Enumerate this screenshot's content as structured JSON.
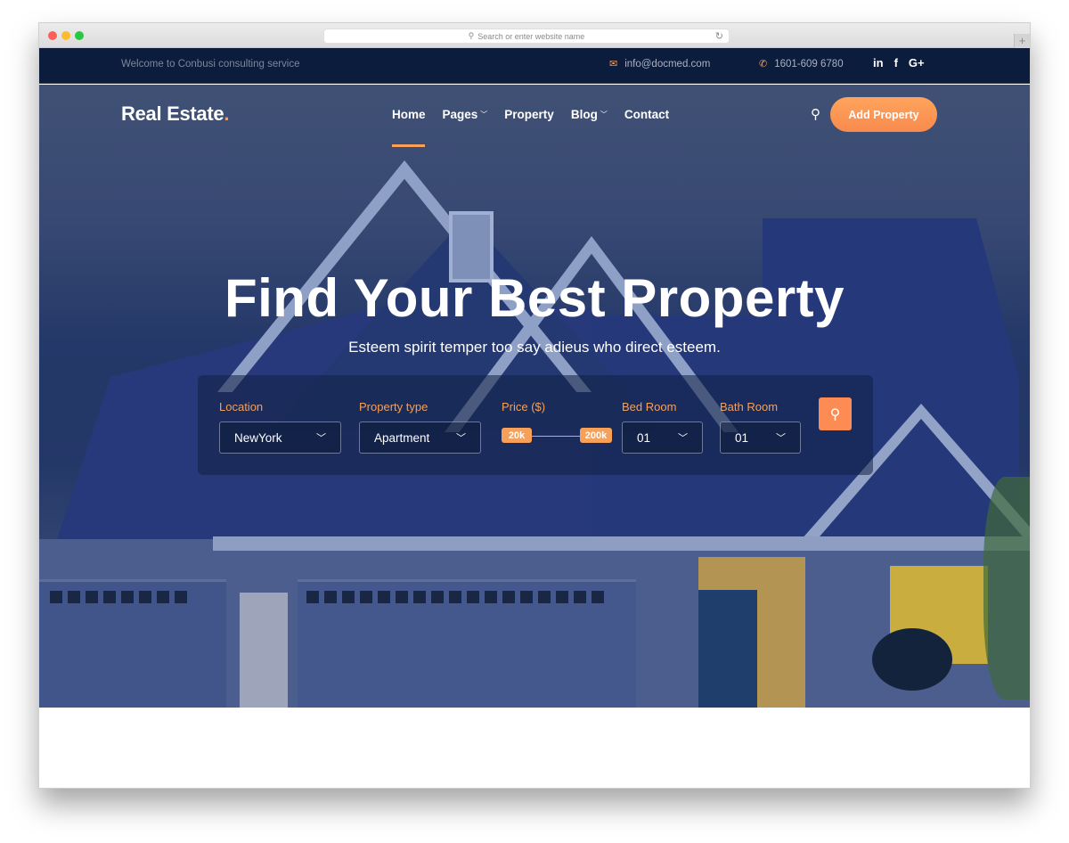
{
  "browser": {
    "url_placeholder": "Search or enter website name",
    "search_icon": "magnifier-icon",
    "reload_icon": "reload-icon",
    "new_tab": "+"
  },
  "topbar": {
    "welcome": "Welcome to Conbusi consulting service",
    "email": "info@docmed.com",
    "phone": "1601-609 6780",
    "email_icon": "✉",
    "phone_icon": "✆",
    "social": [
      "in",
      "f",
      "G+"
    ]
  },
  "nav": {
    "logo": "Real Estate",
    "logo_dot": ".",
    "items": [
      {
        "label": "Home",
        "active": true,
        "dropdown": false
      },
      {
        "label": "Pages",
        "active": false,
        "dropdown": true
      },
      {
        "label": "Property",
        "active": false,
        "dropdown": false
      },
      {
        "label": "Blog",
        "active": false,
        "dropdown": true
      },
      {
        "label": "Contact",
        "active": false,
        "dropdown": false
      }
    ],
    "search_icon": "⚲",
    "cta": "Add Property"
  },
  "hero": {
    "title": "Find Your Best Property",
    "subtitle": "Esteem spirit temper too say adieus who direct esteem."
  },
  "search": {
    "location": {
      "label": "Location",
      "value": "NewYork"
    },
    "property_type": {
      "label": "Property type",
      "value": "Apartment"
    },
    "price": {
      "label": "Price ($)",
      "min": "20k",
      "max": "200k"
    },
    "bed_room": {
      "label": "Bed Room",
      "value": "01"
    },
    "bath_room": {
      "label": "Bath Room",
      "value": "01"
    },
    "chevron": "⌄",
    "submit_icon": "⚲"
  },
  "colors": {
    "accent": "#f6a05a",
    "topbar_bg": "#0c1c3c",
    "button": "#fd8c54"
  }
}
